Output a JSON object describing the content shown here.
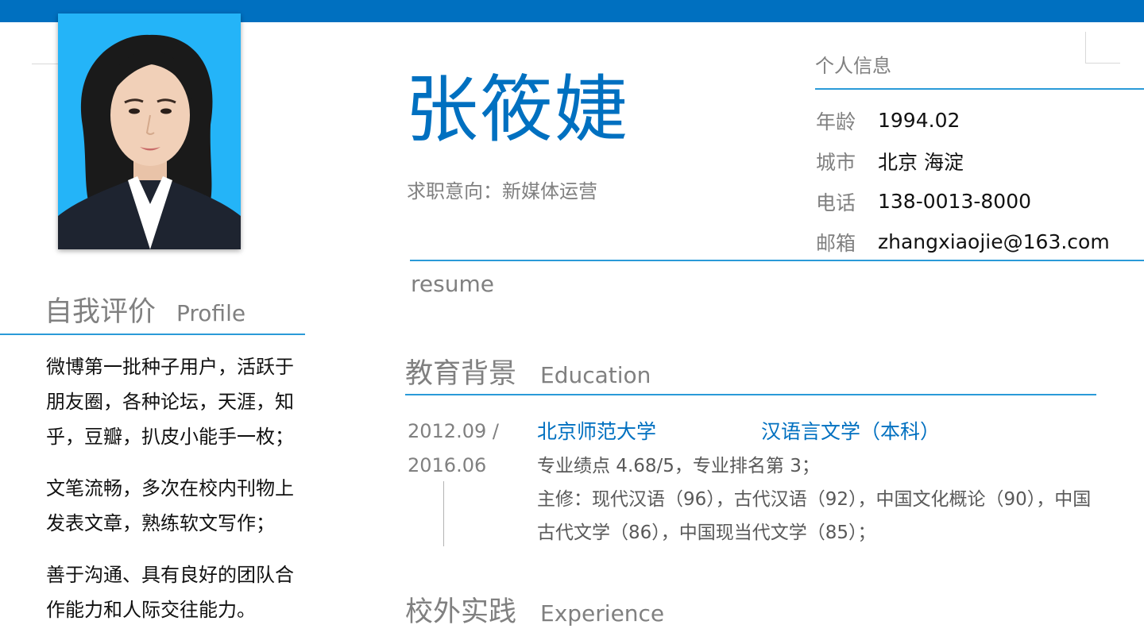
{
  "name": "张筱婕",
  "job_intent": "求职意向：新媒体运营",
  "resume_label": "resume",
  "personal_info": {
    "title": "个人信息",
    "rows": [
      {
        "label": "年龄",
        "value": "1994.02"
      },
      {
        "label": "城市",
        "value": "北京 海淀"
      },
      {
        "label": "电话",
        "value": "138-0013-8000"
      },
      {
        "label": "邮箱",
        "value": "zhangxiaojie@163.com"
      }
    ]
  },
  "profile": {
    "title_cn": "自我评价",
    "title_en": "Profile",
    "paragraphs": [
      "微博第一批种子用户，活跃于朋友圈，各种论坛，天涯，知乎，豆瓣，扒皮小能手一枚；",
      "文笔流畅，多次在校内刊物上发表文章，熟练软文写作；",
      "善于沟通、具有良好的团队合作能力和人际交往能力。"
    ]
  },
  "education": {
    "title_cn": "教育背景",
    "title_en": "Education",
    "date_start": "2012.09 /",
    "date_end": "2016.06",
    "school": "北京师范大学",
    "major": "汉语言文学（本科）",
    "details": [
      "专业绩点 4.68/5，专业排名第 3；",
      "主修：现代汉语（96），古代汉语（92），中国文化概论（90），中国古代文学（86），中国现当代文学（85）；"
    ]
  },
  "experience": {
    "title_cn": "校外实践",
    "title_en": "Experience"
  },
  "colors": {
    "accent": "#0070c0",
    "rule": "#2a9ad8",
    "muted": "#808080",
    "photo_bg": "#24b4f8"
  }
}
